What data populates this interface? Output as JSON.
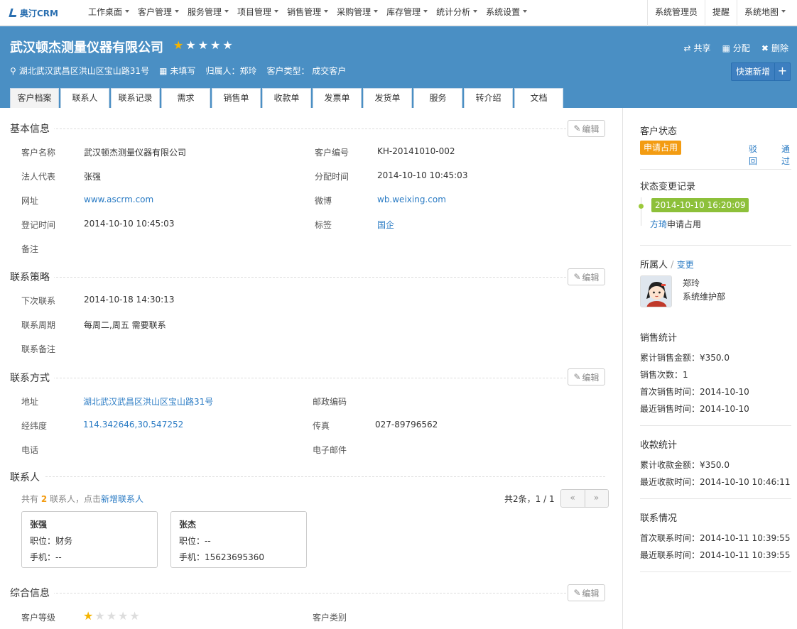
{
  "topnav": {
    "logo": "奥汀CRM",
    "items": [
      "工作桌面",
      "客户管理",
      "服务管理",
      "项目管理",
      "销售管理",
      "采购管理",
      "库存管理",
      "统计分析",
      "系统设置"
    ],
    "right": {
      "user": "系统管理员",
      "remind": "提醒",
      "sitemap": "系统地图"
    }
  },
  "header": {
    "company": "武汉顿杰测量仪器有限公司",
    "rating": 1,
    "rating_max": 5,
    "address": "湖北武汉武昌区洪山区宝山路31号",
    "unfilled": "未填写",
    "owner": "归属人：郑玲",
    "ctype": "客户类型： 成交客户",
    "actions": {
      "share": "共享",
      "assign": "分配",
      "delete": "删除"
    },
    "quick_add": "快速新增"
  },
  "tabs": [
    "客户档案",
    "联系人",
    "联系记录",
    "需求",
    "销售单",
    "收款单",
    "发票单",
    "发货单",
    "服务",
    "转介绍",
    "文档"
  ],
  "edit_label": "编辑",
  "basic": {
    "title": "基本信息",
    "name_l": "客户名称",
    "name_v": "武汉顿杰测量仪器有限公司",
    "code_l": "客户编号",
    "code_v": "KH-20141010-002",
    "legal_l": "法人代表",
    "legal_v": "张强",
    "assign_l": "分配时间",
    "assign_v": "2014-10-10 10:45:03",
    "web_l": "网址",
    "web_v": "www.ascrm.com",
    "weibo_l": "微博",
    "weibo_v": "wb.weixing.com",
    "reg_l": "登记时间",
    "reg_v": "2014-10-10 10:45:03",
    "tag_l": "标签",
    "tag_v": "国企",
    "note_l": "备注"
  },
  "strategy": {
    "title": "联系策略",
    "next_l": "下次联系",
    "next_v": "2014-10-18 14:30:13",
    "cycle_l": "联系周期",
    "cycle_v": "每周二,周五 需要联系",
    "note_l": "联系备注"
  },
  "contact": {
    "title": "联系方式",
    "addr_l": "地址",
    "addr_v": "湖北武汉武昌区洪山区宝山路31号",
    "zip_l": "邮政编码",
    "geo_l": "经纬度",
    "geo_v": "114.342646,30.547252",
    "fax_l": "传真",
    "fax_v": "027-89796562",
    "tel_l": "电话",
    "email_l": "电子邮件"
  },
  "people": {
    "title": "联系人",
    "hint_pre": "共有",
    "count": "2",
    "hint_mid": "联系人，点击",
    "add_link": "新增联系人",
    "pager": "共2条，1 / 1",
    "prev": "«",
    "next": "»",
    "cards": [
      {
        "name": "张强",
        "pos": "职位：财务",
        "mobile": "手机：--"
      },
      {
        "name": "张杰",
        "pos": "职位：--",
        "mobile": "手机：15623695360"
      }
    ]
  },
  "general": {
    "title": "综合信息",
    "level_l": "客户等级",
    "level": 1,
    "level_max": 5,
    "cat_l": "客户类别"
  },
  "side": {
    "status_title": "客户状态",
    "status_badge": "申请占用",
    "reject": "驳回",
    "pass": "通过",
    "log_title": "状态变更记录",
    "log_time": "2014-10-10 16:20:09",
    "log_user": "方琦",
    "log_action": "申请占用",
    "owner_title": "所属人",
    "owner_sep": "/",
    "owner_change": "变更",
    "owner_name": "郑玲",
    "owner_dept": "系统维护部",
    "sales_title": "销售统计",
    "sales": [
      "累计销售金额：¥350.0",
      "销售次数：1",
      "首次销售时间：2014-10-10",
      "最近销售时间：2014-10-10"
    ],
    "pay_title": "收款统计",
    "pay": [
      "累计收款金额：¥350.0",
      "最近收款时间：2014-10-10 10:46:11"
    ],
    "contact_title": "联系情况",
    "contact": [
      "首次联系时间：2014-10-11 10:39:55",
      "最近联系时间：2014-10-11 10:39:55"
    ]
  },
  "colors": {
    "banner": "#4a8fc4",
    "link": "#2a7bc4",
    "orange": "#f39c12",
    "green": "#8dc03a",
    "star": "#f5b400"
  }
}
